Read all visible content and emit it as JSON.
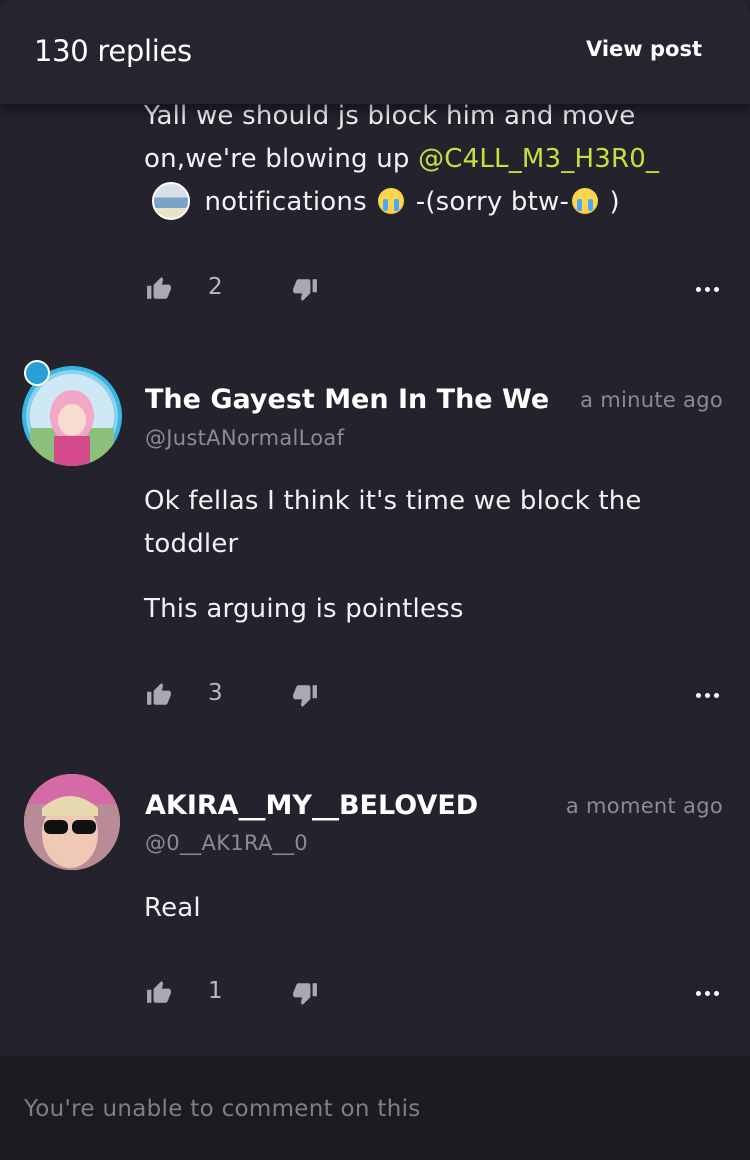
{
  "header": {
    "title": "130 replies",
    "view_post_label": "View post"
  },
  "comments": [
    {
      "text_part1": "Yall we should js block him and move on,we're blowing up ",
      "mention": "@C4LL_M3_H3R0_",
      "text_part2": " notifications ",
      "text_part3": " -(sorry btw-",
      "text_part4": " )",
      "likes": "2"
    },
    {
      "display_name": "The Gayest Men In The West",
      "handle": "@JustANormalLoaf",
      "time": "a minute ago",
      "paragraph1": "Ok fellas I think it's time we block the toddler",
      "paragraph2": "This arguing is pointless",
      "likes": "3"
    },
    {
      "display_name": "AKIRA__MY__BELOVED",
      "handle": "@0__AK1RA__0",
      "time": "a moment ago",
      "paragraph1": "Real",
      "likes": "1"
    }
  ],
  "footer": {
    "message": "You're unable to comment on this"
  },
  "icons": {
    "like": "thumbs-up-icon",
    "dislike": "thumbs-down-icon",
    "more": "more-dots-icon",
    "emoji": "loudly-crying-face-emoji"
  },
  "colors": {
    "background": "#24222c",
    "mention": "#c6e23a",
    "muted": "#8c8b95"
  }
}
